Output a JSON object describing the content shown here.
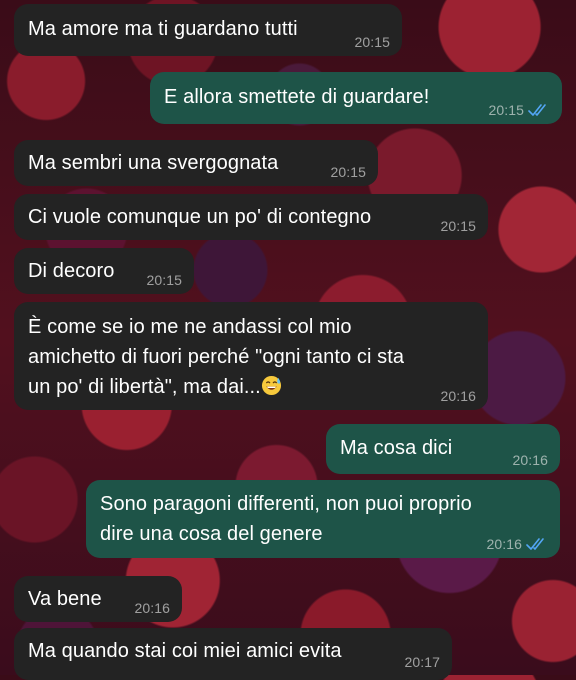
{
  "messages": [
    {
      "direction": "in",
      "text": "Ma amore ma ti guardano tutti",
      "time": "20:15"
    },
    {
      "direction": "out",
      "text": "E allora smettete di guardare!",
      "time": "20:15",
      "status": "read"
    },
    {
      "direction": "in",
      "text": "Ma sembri una svergognata",
      "time": "20:15"
    },
    {
      "direction": "in",
      "text": "Ci vuole comunque un po' di contegno",
      "time": "20:15"
    },
    {
      "direction": "in",
      "text": "Di decoro",
      "time": "20:15"
    },
    {
      "direction": "in",
      "text": "È come se io me ne andassi col mio\namichetto di fuori perché \"ogni tanto ci sta\nun po' di libertà\", ma dai...",
      "emoji": "sweat-smile",
      "time": "20:16"
    },
    {
      "direction": "out",
      "text": "Ma cosa dici",
      "time": "20:16"
    },
    {
      "direction": "out",
      "text": "Sono paragoni differenti, non puoi proprio\ndire una cosa del genere",
      "time": "20:16",
      "status": "read"
    },
    {
      "direction": "in",
      "text": "Va bene",
      "time": "20:16"
    },
    {
      "direction": "in",
      "text": "Ma quando stai coi miei amici evita",
      "time": "20:17"
    }
  ],
  "colors": {
    "incoming_bubble": "#232323",
    "outgoing_bubble": "#1e5448",
    "read_ticks": "#53a6f5"
  }
}
